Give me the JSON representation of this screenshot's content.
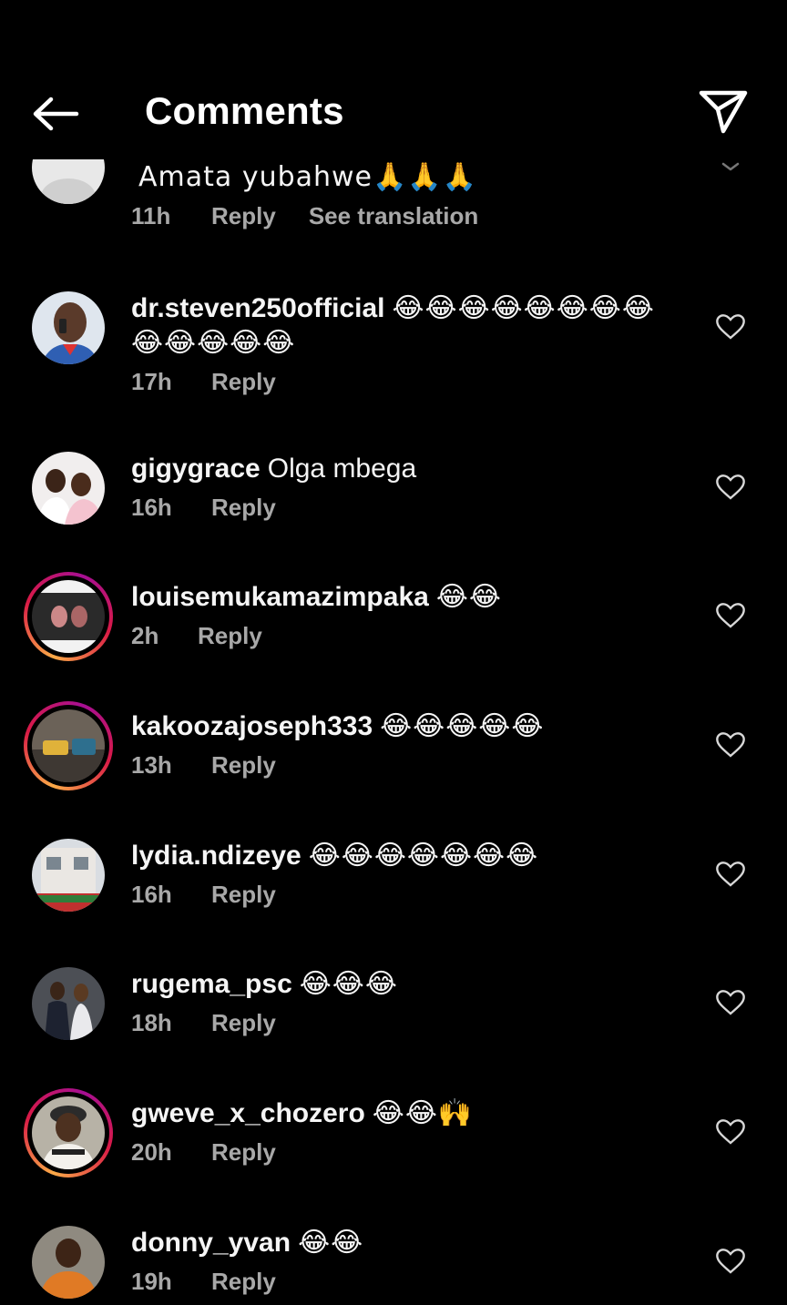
{
  "header": {
    "title": "Comments",
    "back_icon": "arrow-left-icon",
    "share_icon": "paper-plane-icon"
  },
  "comments": [
    {
      "username": "",
      "text": "Amata yubahwe🙏🙏🙏",
      "time": "11h",
      "reply": "Reply",
      "translate": "See translation",
      "avatar": "default",
      "story": false
    },
    {
      "username": "dr.steven250official",
      "text": "😂😂😂😂😂😂😂😂😂😂😂😂😂",
      "time": "17h",
      "reply": "Reply",
      "avatar": "man-phone",
      "story": false
    },
    {
      "username": "gigygrace",
      "text": "Olga mbega",
      "time": "16h",
      "reply": "Reply",
      "avatar": "couple",
      "story": false
    },
    {
      "username": "louisemukamazimpaka",
      "text": "😂😂",
      "time": "2h",
      "reply": "Reply",
      "avatar": "poster",
      "story": true
    },
    {
      "username": "kakoozajoseph333",
      "text": "😂😂😂😂😂",
      "time": "13h",
      "reply": "Reply",
      "avatar": "sofa",
      "story": true
    },
    {
      "username": "lydia.ndizeye",
      "text": "😂😂😂😂😂😂😂",
      "time": "16h",
      "reply": "Reply",
      "avatar": "building",
      "story": false
    },
    {
      "username": "rugema_psc",
      "text": "😂😂😂",
      "time": "18h",
      "reply": "Reply",
      "avatar": "wedding",
      "story": false
    },
    {
      "username": "gweve_x_chozero",
      "text": "😂😂🙌",
      "time": "20h",
      "reply": "Reply",
      "avatar": "cap-man",
      "story": true
    },
    {
      "username": "donny_yvan",
      "text": "😂😂",
      "time": "19h",
      "reply": "Reply",
      "avatar": "man-orange",
      "story": false
    }
  ],
  "colors": {
    "background": "#000000",
    "text": "#f5f5f5",
    "meta": "#a8a8a8",
    "story_ring_start": "#fbaa47",
    "story_ring_end": "#a60f93"
  }
}
